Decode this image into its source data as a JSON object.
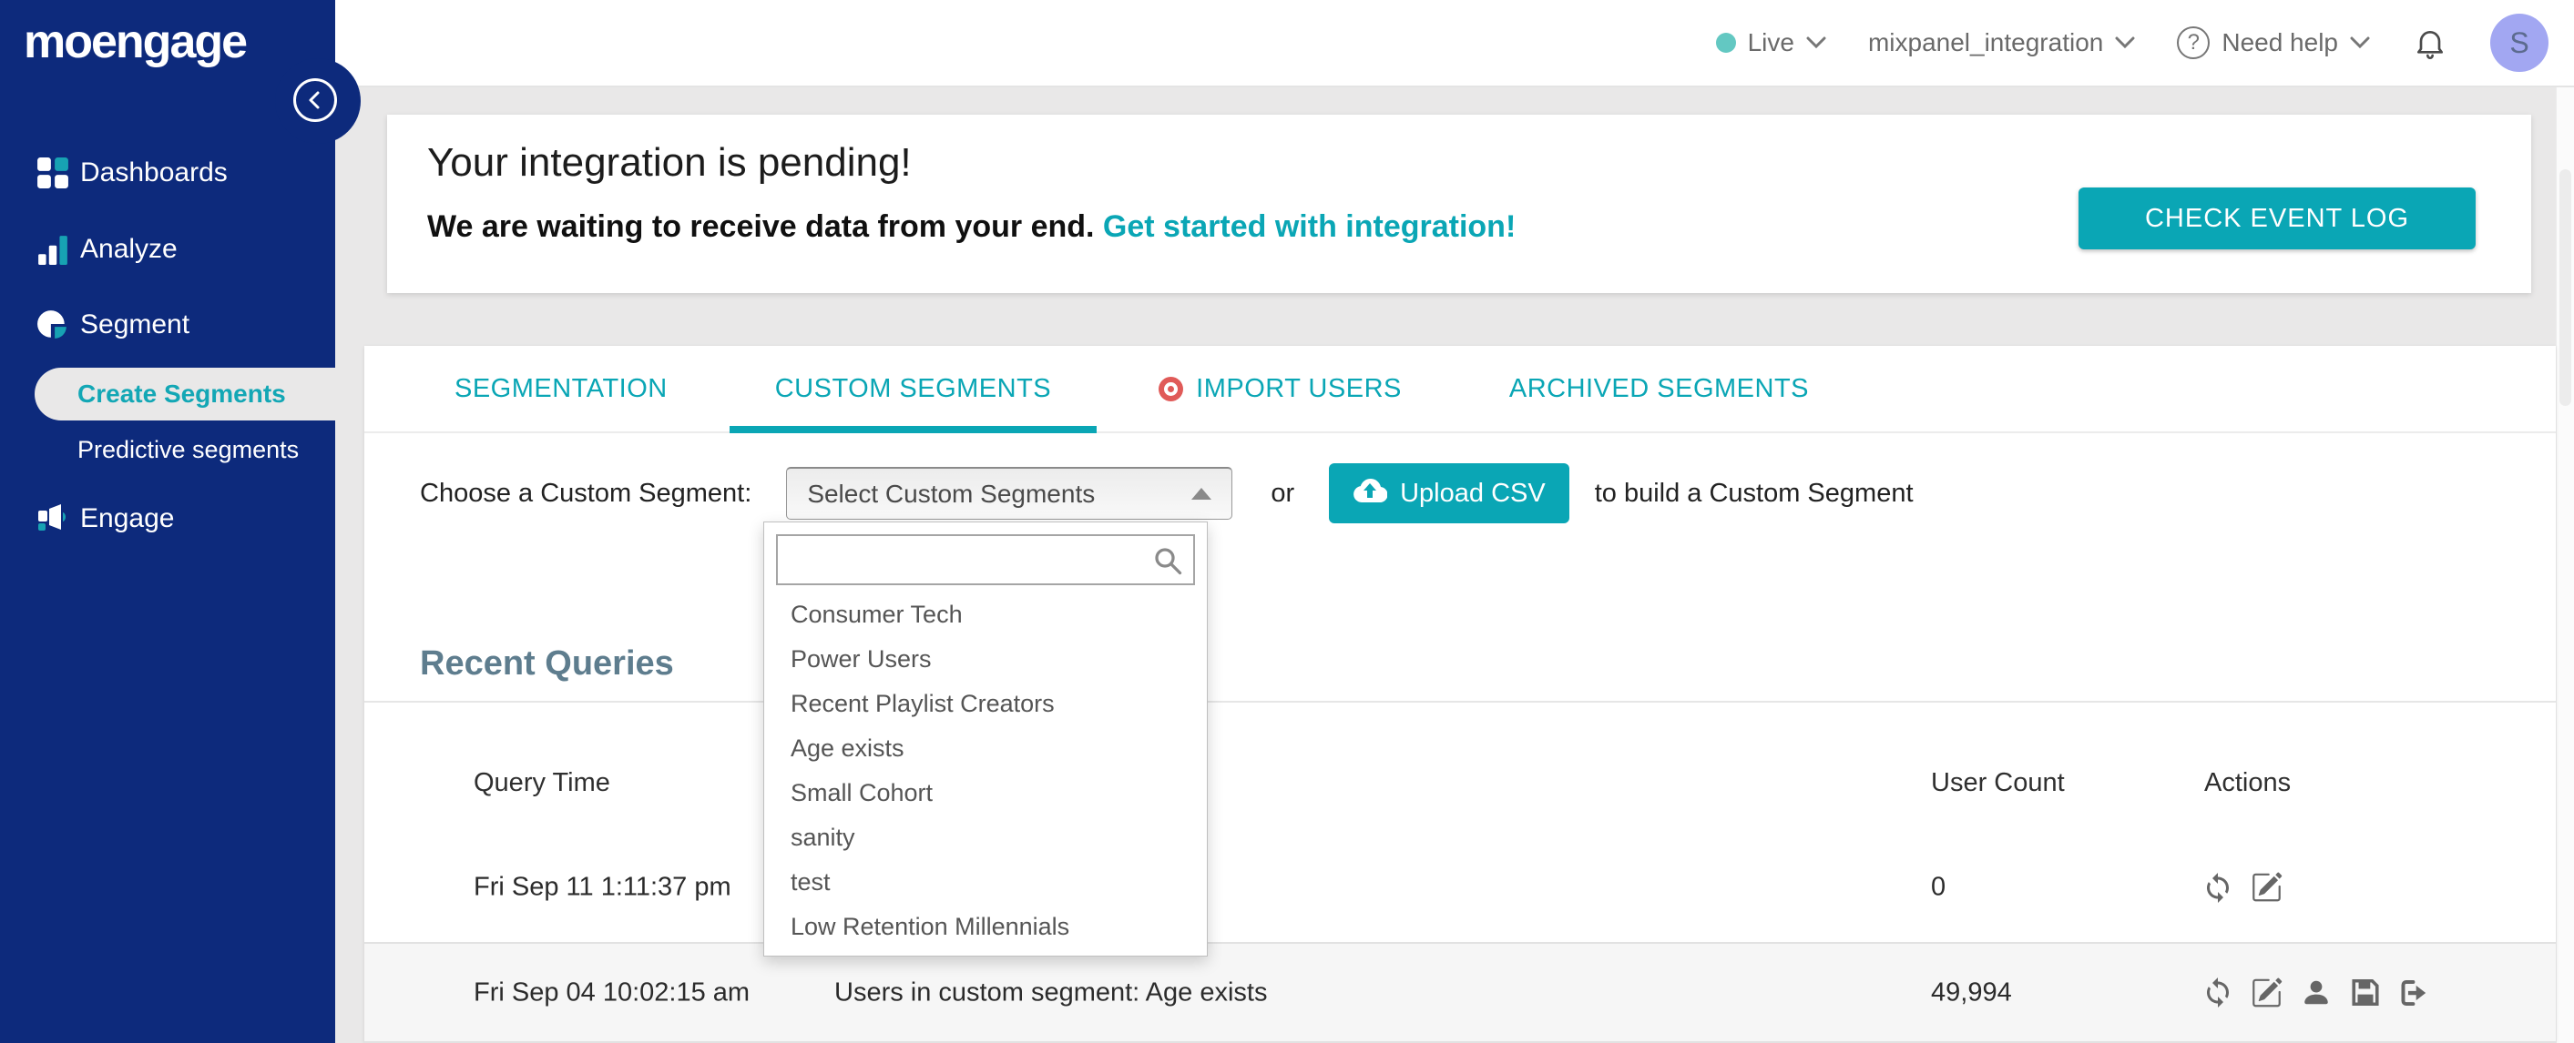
{
  "app": {
    "logo_text": "moengage"
  },
  "header": {
    "environment": {
      "label": "Live",
      "dot_color": "#63c8c2"
    },
    "workspace": "mixpanel_integration",
    "help_label": "Need help",
    "icons": [
      "question-circle-icon",
      "bell-icon"
    ],
    "avatar_initial": "S"
  },
  "sidebar": {
    "collapse_icon": "chevron-left-icon",
    "items": [
      {
        "label": "Dashboards",
        "icon": "grid-icon"
      },
      {
        "label": "Analyze",
        "icon": "bar-chart-icon"
      },
      {
        "label": "Segment",
        "icon": "pie-chart-icon"
      }
    ],
    "segment_children": [
      {
        "label": "Create Segments",
        "active": true
      },
      {
        "label": "Predictive segments",
        "active": false
      }
    ],
    "engage": {
      "label": "Engage",
      "icon": "megaphone-icon"
    }
  },
  "banner": {
    "title": "Your integration is pending!",
    "message": "We are waiting to receive data from your end.",
    "link_text": "Get started with integration!",
    "button": "CHECK EVENT LOG"
  },
  "tabs": [
    {
      "label": "SEGMENTATION",
      "active": false
    },
    {
      "label": "CUSTOM SEGMENTS",
      "active": true
    },
    {
      "label": "IMPORT USERS",
      "active": false,
      "icon": "record-dot-icon"
    },
    {
      "label": "ARCHIVED SEGMENTS",
      "active": false
    }
  ],
  "chooser": {
    "label": "Choose a Custom Segment:",
    "select_value": "Select Custom Segments",
    "select_arrow": "triangle-up-icon",
    "or_text": "or",
    "upload_button": "Upload CSV",
    "upload_icon": "cloud-upload-icon",
    "suffix_text": "to build a Custom Segment"
  },
  "segment_dropdown": {
    "search_value": "",
    "search_icon": "magnifier-icon",
    "items": [
      "Consumer Tech",
      "Power Users",
      "Recent Playlist Creators",
      "Age exists",
      "Small Cohort",
      "sanity",
      "test",
      "Low Retention Millennials"
    ]
  },
  "recent_queries": {
    "title": "Recent Queries",
    "columns": {
      "time": "Query Time",
      "user_count": "User Count",
      "actions": "Actions"
    },
    "rows": [
      {
        "time": "Fri Sep 11 1:11:37 pm",
        "query": "",
        "user_count": "0",
        "actions": [
          "refresh-icon",
          "edit-icon"
        ]
      },
      {
        "time": "Fri Sep 04 10:02:15 am",
        "query": "Users in custom segment: Age exists",
        "user_count": "49,994",
        "actions": [
          "refresh-icon",
          "edit-icon",
          "user-icon",
          "save-icon",
          "export-icon"
        ]
      }
    ]
  },
  "colors": {
    "sidebar_navy": "#0d2a7c",
    "teal_accent": "#0aa6b5",
    "page_bg": "#e9e8e8",
    "coral_dot": "#e05a58",
    "avatar_bg": "#a2a7f2",
    "live_dot": "#63c8c2",
    "heading_slate": "#5e7d8e"
  }
}
